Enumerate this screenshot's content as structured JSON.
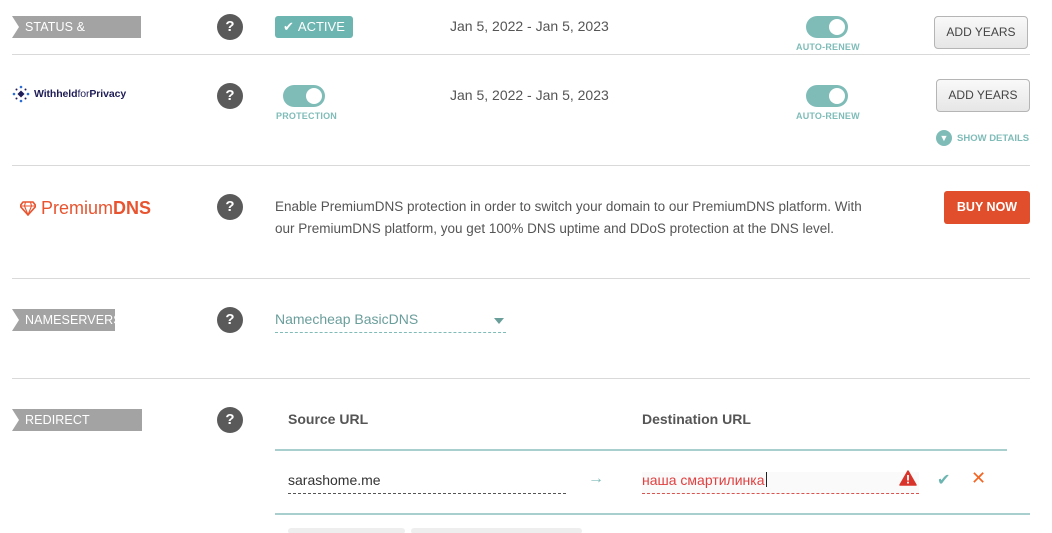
{
  "status_section": {
    "label": "STATUS & VALIDITY",
    "help": "?",
    "badge": "ACTIVE",
    "dates": "Jan 5, 2022 - Jan 5, 2023",
    "auto_renew_label": "AUTO-RENEW",
    "auto_renew_on": true,
    "add_years": "ADD YEARS"
  },
  "privacy_section": {
    "logo_bold": "Withheld",
    "logo_light": "for",
    "logo_bold2": "Privacy",
    "help": "?",
    "protection_label": "PROTECTION",
    "protection_on": true,
    "dates": "Jan 5, 2022 - Jan 5, 2023",
    "auto_renew_label": "AUTO-RENEW",
    "auto_renew_on": true,
    "add_years": "ADD YEARS",
    "show_details": "SHOW DETAILS"
  },
  "premium_dns": {
    "logo_regular": "Premium",
    "logo_bold": "DNS",
    "help": "?",
    "description": "Enable PremiumDNS protection in order to switch your domain to our PremiumDNS platform. With our PremiumDNS platform, you get 100% DNS uptime and DDoS protection at the DNS level.",
    "buy_now": "BUY NOW"
  },
  "nameservers": {
    "label": "NAMESERVERS",
    "help": "?",
    "selected": "Namecheap BasicDNS"
  },
  "redirect": {
    "label": "REDIRECT DOMAIN",
    "help": "?",
    "source_header": "Source URL",
    "destination_header": "Destination URL",
    "source_value": "sarashome.me",
    "arrow": "→",
    "destination_value": "наша смартилинка"
  },
  "icons": {
    "warning": "warning-triangle-icon",
    "confirm": "checkmark-icon",
    "cancel": "close-icon",
    "check_glyph": "✔",
    "x_glyph": "✕"
  },
  "colors": {
    "teal": "#7fbcb8",
    "orange": "#e04e2b",
    "label_grey": "#a3a3a3",
    "error_red": "#e04040"
  }
}
